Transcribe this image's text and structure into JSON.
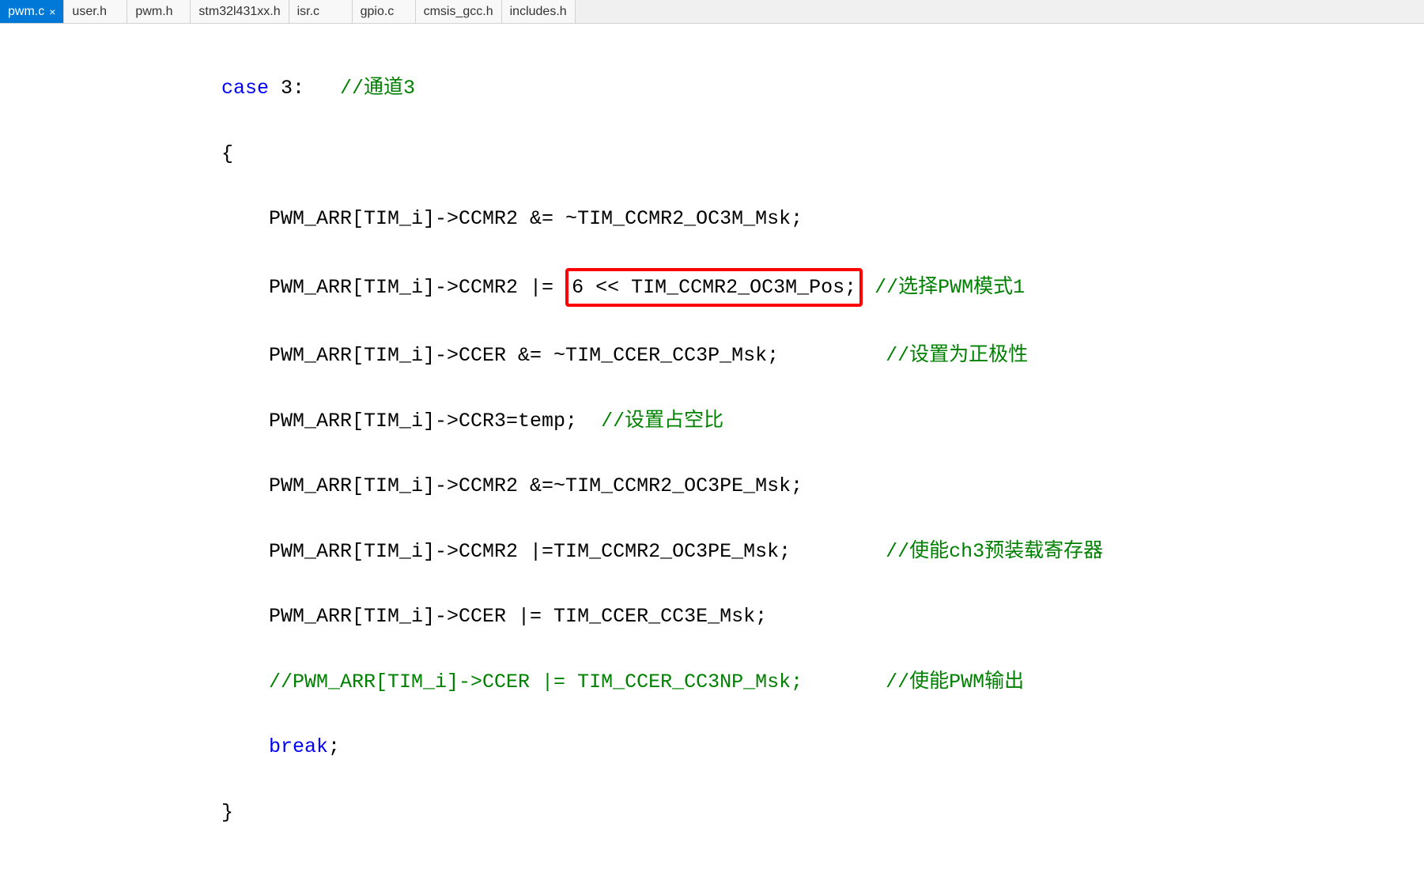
{
  "tabs": [
    {
      "label": "pwm.c",
      "active": true,
      "close": "×"
    },
    {
      "label": "user.h",
      "active": false
    },
    {
      "label": "pwm.h",
      "active": false
    },
    {
      "label": "stm32l431xx.h",
      "active": false
    },
    {
      "label": "isr.c",
      "active": false
    },
    {
      "label": "gpio.c",
      "active": false
    },
    {
      "label": "cmsis_gcc.h",
      "active": false
    },
    {
      "label": "includes.h",
      "active": false
    }
  ],
  "code": {
    "l1_kw": "case",
    "l1_num": " 3",
    "l1_colon": ":   ",
    "l1_comment": "//通道3",
    "l2": "{",
    "l3a": "PWM_ARR[TIM_i]->CCMR2 &= ~TIM_CCMR2_OC3M_Msk;",
    "l4a": "PWM_ARR[TIM_i]->CCMR2 |= ",
    "l4box": "6 << TIM_CCMR2_OC3M_Pos;",
    "l4c": " //选择PWM模式1",
    "l5a": "PWM_ARR[TIM_i]->CCER &= ~TIM_CCER_CC3P_Msk;         ",
    "l5c": "//设置为正极性",
    "l6a": "PWM_ARR[TIM_i]->CCR3=temp;  ",
    "l6c": "//设置占空比",
    "l7": "PWM_ARR[TIM_i]->CCMR2 &=~TIM_CCMR2_OC3PE_Msk;",
    "l8a": "PWM_ARR[TIM_i]->CCMR2 |=TIM_CCMR2_OC3PE_Msk;        ",
    "l8c": "//使能ch3预装载寄存器",
    "l9": "PWM_ARR[TIM_i]->CCER |= TIM_CCER_CC3E_Msk;",
    "l10a": "//PWM_ARR[TIM_i]->CCER |= TIM_CCER_CC3NP_Msk;       //使能PWM输出",
    "l11_kw": "break",
    "l11_sc": ";",
    "l12": "}"
  }
}
